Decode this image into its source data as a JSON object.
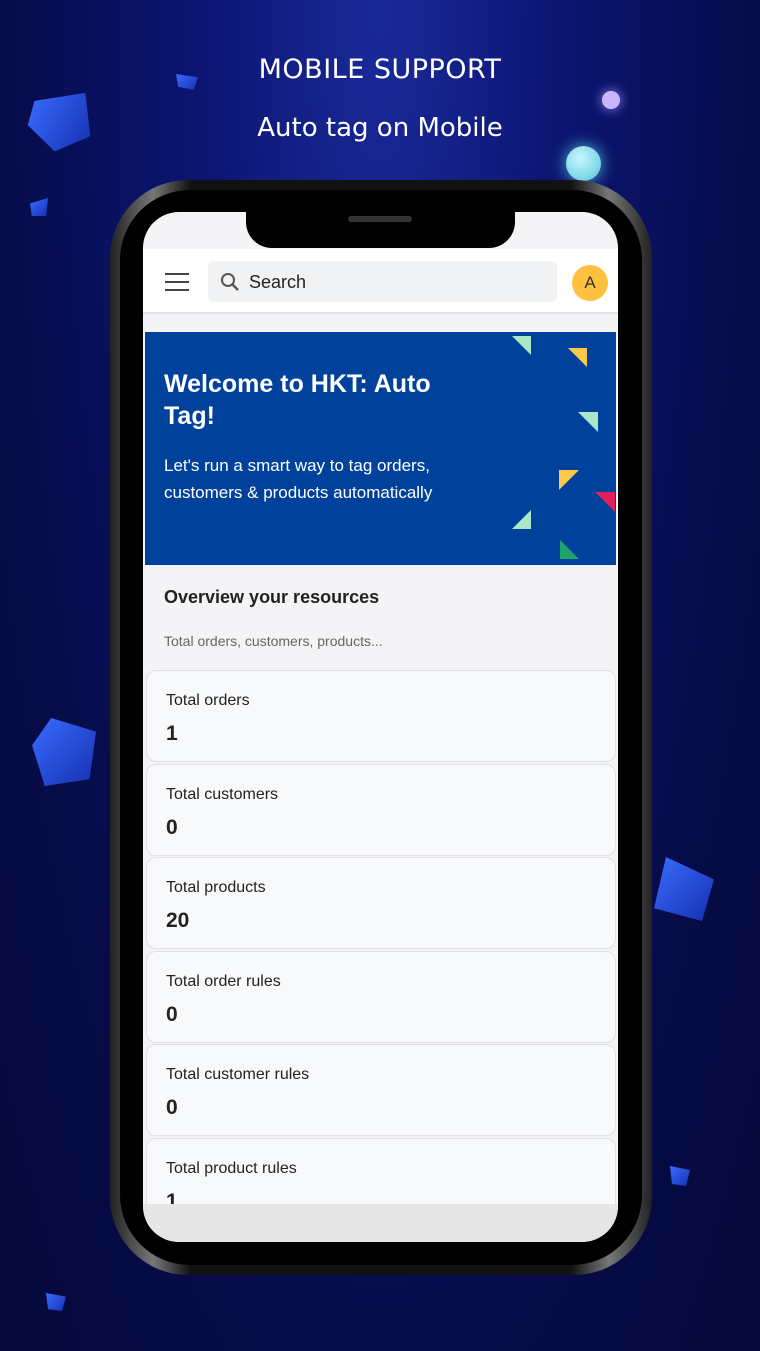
{
  "header": {
    "title": "MOBILE SUPPORT",
    "subtitle": "Auto tag on Mobile"
  },
  "topbar": {
    "search_placeholder": "Search",
    "avatar_initial": "A"
  },
  "banner": {
    "title": "Welcome to HKT: Auto Tag!",
    "subtitle": "Let's run a smart way to tag orders, customers & products automatically",
    "color": "#00429b"
  },
  "overview": {
    "title": "Overview your resources",
    "subtitle": "Total orders, customers, products..."
  },
  "cards": [
    {
      "label": "Total orders",
      "value": "1"
    },
    {
      "label": "Total customers",
      "value": "0"
    },
    {
      "label": "Total products",
      "value": "20"
    },
    {
      "label": "Total order rules",
      "value": "0"
    },
    {
      "label": "Total customer rules",
      "value": "0"
    },
    {
      "label": "Total product rules",
      "value": "1"
    }
  ]
}
